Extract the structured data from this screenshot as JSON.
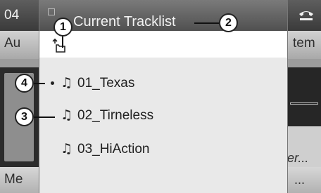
{
  "background": {
    "clock": "04",
    "left_top_label": "Au",
    "right_top_label": "tem",
    "right_lower_label": "er...",
    "bottom_left_label": "Me",
    "bottom_right_label": "..."
  },
  "popup": {
    "title": "Current Tracklist",
    "folder_up_icon": "folder-up-icon",
    "tracks": [
      {
        "label": "01_Texas",
        "current": true,
        "icon": "music-note-icon"
      },
      {
        "label": "02_Tirneless",
        "current": false,
        "icon": "music-note-icon"
      },
      {
        "label": "03_HiAction",
        "current": false,
        "icon": "music-note-icon"
      }
    ],
    "note_glyph": "♫"
  },
  "callouts": {
    "c1": "1",
    "c2": "2",
    "c3": "3",
    "c4": "4"
  },
  "colors": {
    "popup_background": "#e9e9e9",
    "header_background": "#505050",
    "folder_row_background": "#ffffff",
    "screen_background": "#9c9c9c"
  }
}
